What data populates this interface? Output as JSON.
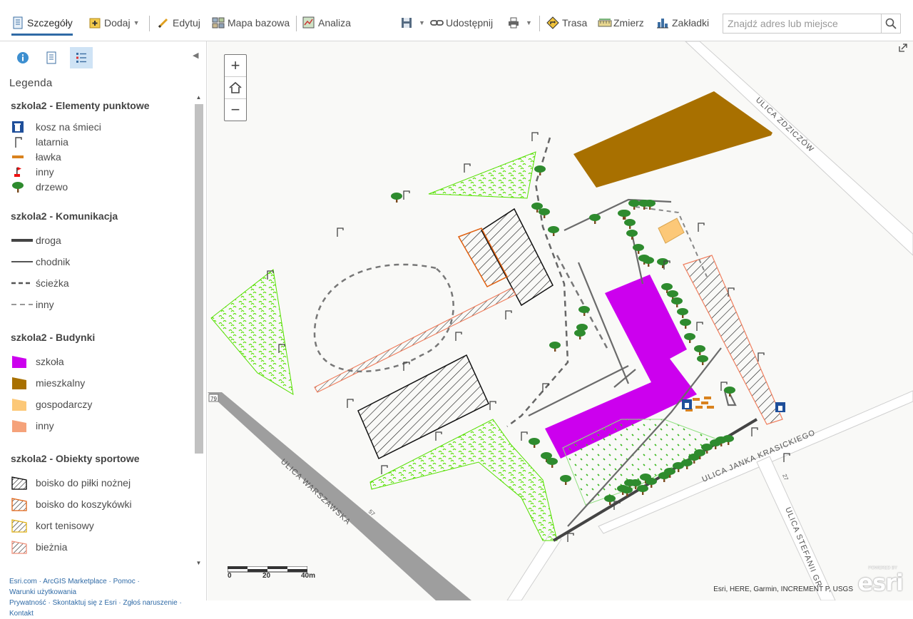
{
  "toolbar": {
    "details": "Szczegóły",
    "add": "Dodaj",
    "edit": "Edytuj",
    "basemap": "Mapa bazowa",
    "analysis": "Analiza",
    "share": "Udostępnij",
    "route": "Trasa",
    "measure": "Zmierz",
    "bookmarks": "Zakładki",
    "search_placeholder": "Znajdź adres lub miejsce"
  },
  "legend": {
    "title": "Legenda",
    "groups": [
      {
        "title": "szkola2 - Elementy punktowe",
        "items": [
          "kosz na śmieci",
          "latarnia",
          "ławka",
          "inny",
          "drzewo"
        ]
      },
      {
        "title": "szkola2 - Komunikacja",
        "items": [
          "droga",
          "chodnik",
          "ścieżka",
          "inny"
        ]
      },
      {
        "title": "szkola2 - Budynki",
        "items": [
          "szkoła",
          "mieszkalny",
          "gospodarczy",
          "inny"
        ]
      },
      {
        "title": "szkola2 - Obiekty sportowe",
        "items": [
          "boisko do piłki nożnej",
          "boisko do koszykówki",
          "kort tenisowy",
          "bieżnia"
        ]
      }
    ]
  },
  "footer": {
    "links": [
      "Esri.com",
      "ArcGIS Marketplace",
      "Pomoc",
      "Warunki użytkowania",
      "Prywatność",
      "Skontaktuj się z Esri",
      "Zgłoś naruszenie",
      "Kontakt"
    ]
  },
  "map": {
    "streets": [
      "ULICA ZDZICZÓW",
      "ULICA WARSZAWSKA",
      "ULICA JANKA KRASICKIEGO",
      "ULICA STEFANII GR"
    ],
    "road_numbers": [
      "79",
      "57",
      "27"
    ],
    "scale_labels": [
      "0",
      "20",
      "40m"
    ],
    "attribution": "Esri, HERE, Garmin, INCREMENT P, USGS",
    "logo": "esri",
    "powered_by": "POWERED BY"
  },
  "colors": {
    "accent": "#2f6aa6",
    "school": "#cc00ee",
    "residential": "#a87000",
    "utility": "#fcc878",
    "other_building": "#f5a27a",
    "tree": "#2e8b2e",
    "grass": "#55e000"
  }
}
